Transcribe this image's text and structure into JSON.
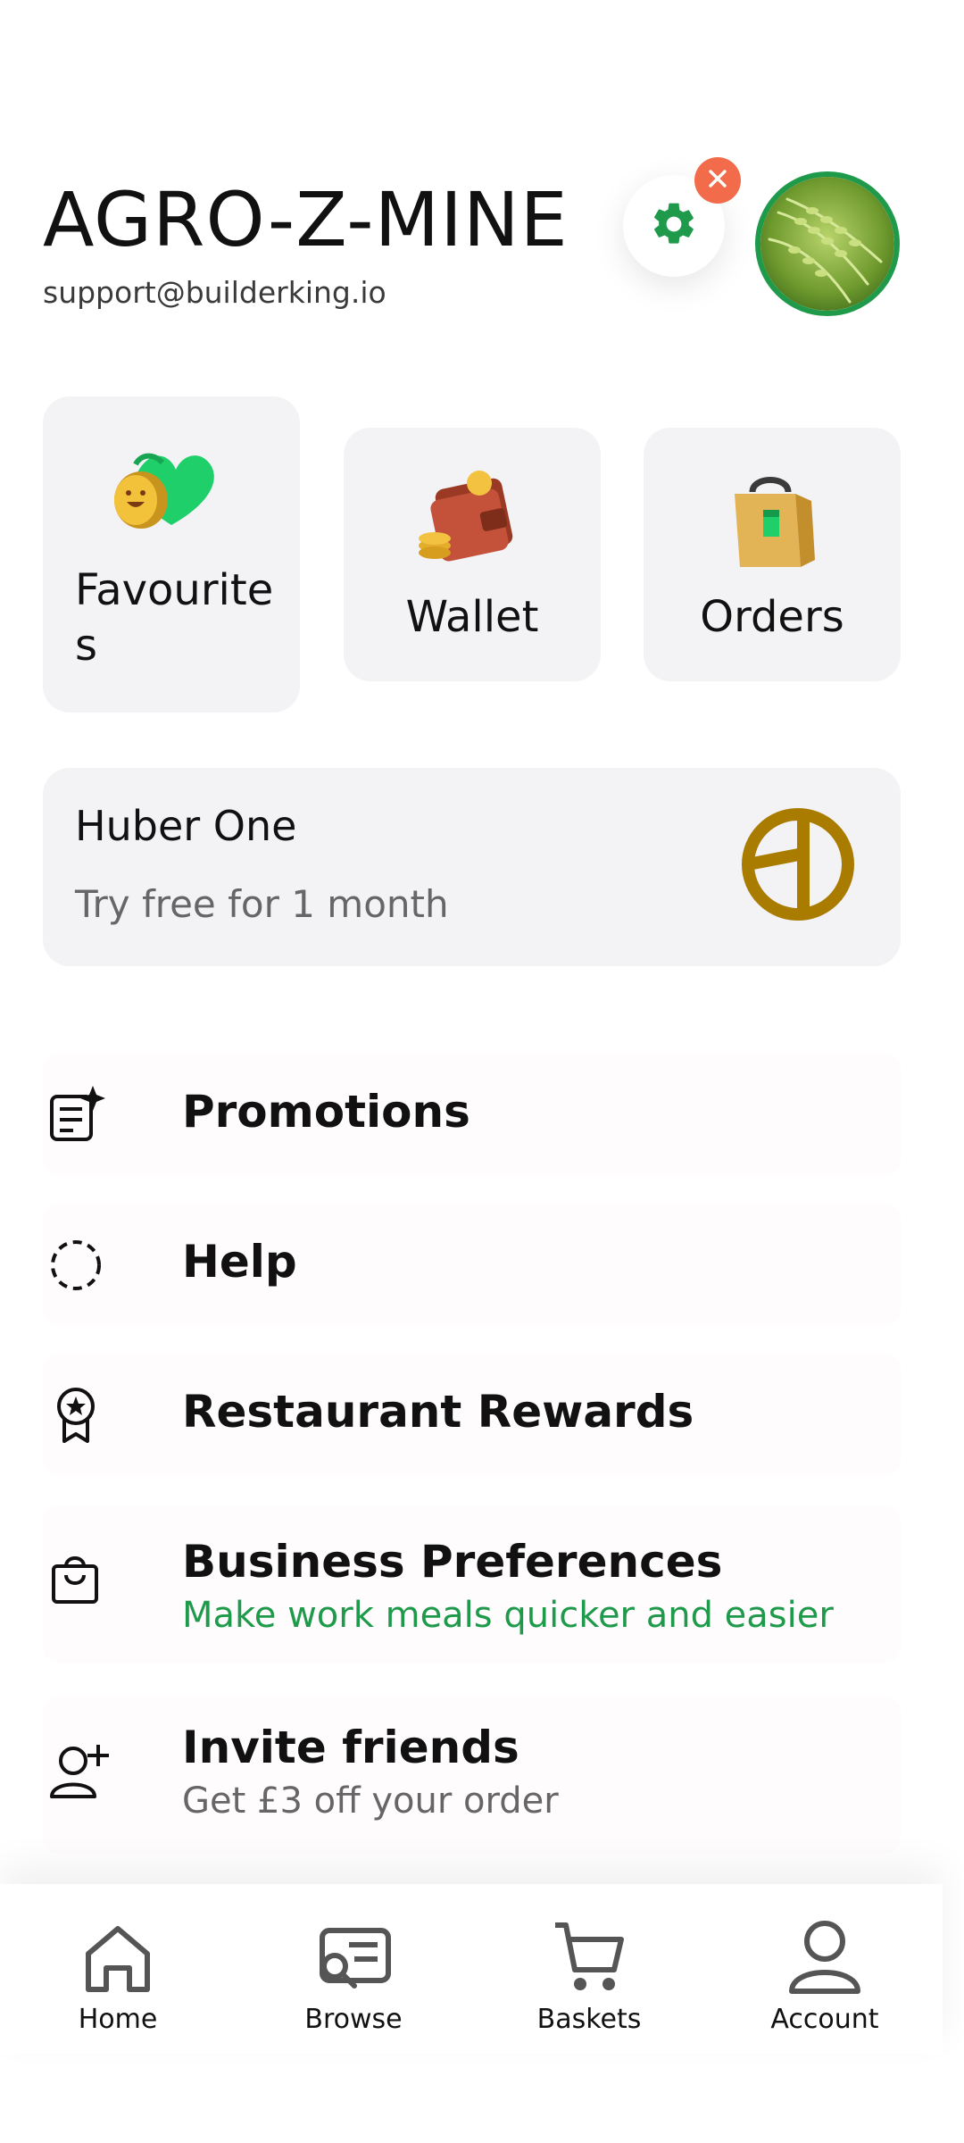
{
  "header": {
    "title": "AGRO-Z-MINE",
    "email": "support@builderking.io"
  },
  "tiles": [
    {
      "label": "Favourite s",
      "line1": "Favourite",
      "line2": "s",
      "icon": "heart-coin-icon"
    },
    {
      "label": "Wallet",
      "icon": "wallet-icon"
    },
    {
      "label": "Orders",
      "icon": "shopping-bag-icon"
    }
  ],
  "promo": {
    "title": "Huber One",
    "subtitle": "Try free for 1 month",
    "icon": "huber-one-logo"
  },
  "menu": [
    {
      "label": "Promotions",
      "icon": "promotions-icon"
    },
    {
      "label": "Help",
      "icon": "help-icon"
    },
    {
      "label": "Restaurant Rewards",
      "icon": "rewards-icon"
    },
    {
      "label": "Business Preferences",
      "subtitle": "Make work meals quicker and easier",
      "icon": "bag-icon"
    },
    {
      "label": "Invite friends",
      "subtitle": "Get £3 off your order",
      "icon": "add-user-icon"
    }
  ],
  "nav": [
    {
      "label": "Home",
      "icon": "home-icon"
    },
    {
      "label": "Browse",
      "icon": "browse-icon"
    },
    {
      "label": "Baskets",
      "icon": "cart-icon"
    },
    {
      "label": "Account",
      "icon": "account-icon"
    }
  ],
  "colors": {
    "accent_green": "#1f9a4b",
    "close_badge": "#f26b4a",
    "promo_logo": "#a97c00",
    "tile_bg": "#f3f2f5"
  }
}
